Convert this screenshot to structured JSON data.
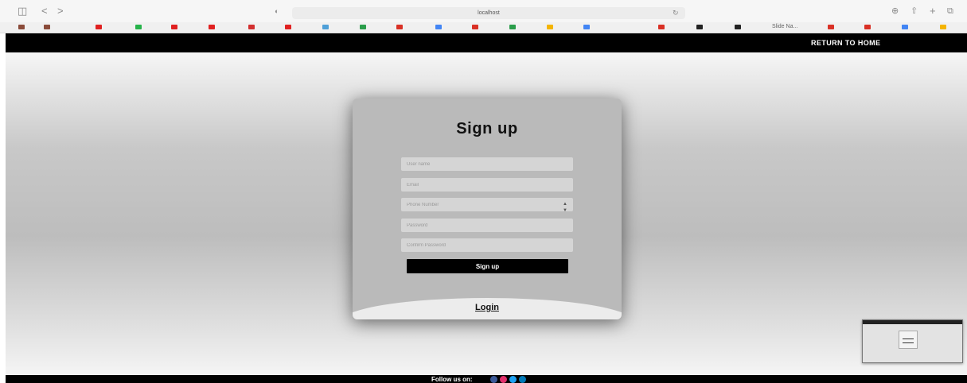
{
  "browser": {
    "url": "localhost",
    "tab_label": "Slide Na..."
  },
  "favorites": [
    {
      "icon": "bookmark-icon",
      "color": "#8a4b3a"
    },
    {
      "icon": "bookmark-icon",
      "color": "#8a4b3a"
    },
    {
      "icon": "youtube-icon",
      "color": "#e02020"
    },
    {
      "icon": "whatsapp-icon",
      "color": "#26b34a"
    },
    {
      "icon": "youtube-icon",
      "color": "#e02020"
    },
    {
      "icon": "youtube-icon",
      "color": "#e02020"
    },
    {
      "icon": "gear-icon",
      "color": "#d22f2f"
    },
    {
      "icon": "youtube-icon",
      "color": "#e02020"
    },
    {
      "icon": "chrome-icon",
      "color": "#4fa0d8"
    },
    {
      "icon": "sheets-icon",
      "color": "#2a9d4a"
    },
    {
      "icon": "gmail-icon",
      "color": "#d93025"
    },
    {
      "icon": "google-icon",
      "color": "#4285f4"
    },
    {
      "icon": "gmail-icon",
      "color": "#d93025"
    },
    {
      "icon": "sheets-icon",
      "color": "#2a9d4a"
    },
    {
      "icon": "slides-icon",
      "color": "#f4b400"
    },
    {
      "icon": "docs-icon",
      "color": "#4285f4"
    },
    {
      "icon": "gmail-icon",
      "color": "#d93025"
    },
    {
      "icon": "github-icon",
      "color": "#222222"
    },
    {
      "icon": "github-icon",
      "color": "#222222"
    },
    {
      "icon": "gmail-icon",
      "color": "#d93025"
    },
    {
      "icon": "gmail-icon",
      "color": "#d93025"
    },
    {
      "icon": "google-icon",
      "color": "#4285f4"
    },
    {
      "icon": "pencil-icon",
      "color": "#f4b400"
    }
  ],
  "header": {
    "return_home": "RETURN TO HOME"
  },
  "form": {
    "title": "Sign up",
    "username_placeholder": "User name",
    "email_placeholder": "Email",
    "phone_placeholder": "Phone Number",
    "password_placeholder": "Password",
    "confirm_placeholder": "Confirm Password",
    "submit_label": "Sign up",
    "login_label": "Login"
  },
  "footer": {
    "follow_label": "Follow us on:",
    "socials": [
      {
        "icon": "facebook-icon",
        "color": "#3b5998"
      },
      {
        "icon": "instagram-icon",
        "color": "#e1306c"
      },
      {
        "icon": "twitter-icon",
        "color": "#1da1f2"
      },
      {
        "icon": "linkedin-icon",
        "color": "#0077b5"
      }
    ]
  }
}
